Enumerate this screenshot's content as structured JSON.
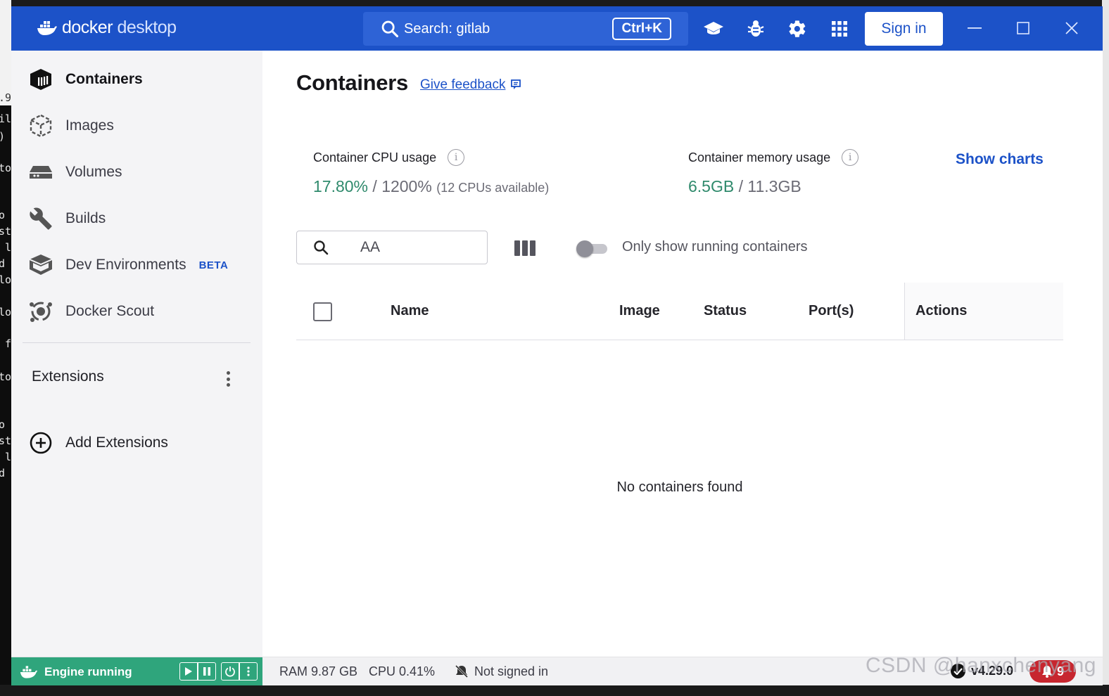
{
  "app": {
    "brand_primary": "docker",
    "brand_secondary": "desktop",
    "accent": "#1c52c8"
  },
  "titlebar": {
    "search_text": "Search: gitlab",
    "search_shortcut": "Ctrl+K",
    "icons": [
      "learning-center-icon",
      "troubleshoot-bug-icon",
      "settings-gear-icon",
      "extensions-grid-icon"
    ],
    "signin_label": "Sign in",
    "window_controls": [
      "minimize",
      "maximize",
      "close"
    ]
  },
  "sidebar": {
    "items": [
      {
        "label": "Containers",
        "icon": "containers-icon",
        "active": true
      },
      {
        "label": "Images",
        "icon": "images-icon"
      },
      {
        "label": "Volumes",
        "icon": "volumes-icon"
      },
      {
        "label": "Builds",
        "icon": "builds-wrench-icon"
      },
      {
        "label": "Dev Environments",
        "icon": "dev-environments-icon",
        "badge": "BETA"
      },
      {
        "label": "Docker Scout",
        "icon": "docker-scout-icon"
      }
    ],
    "extensions_title": "Extensions",
    "add_extensions_label": "Add Extensions"
  },
  "main": {
    "title": "Containers",
    "feedback_label": "Give feedback",
    "cpu": {
      "label": "Container CPU usage",
      "used": "17.80%",
      "sep": " / ",
      "total": "1200%",
      "note": "(12 CPUs available)"
    },
    "memory": {
      "label": "Container memory usage",
      "used": "6.5GB",
      "sep": " / ",
      "total": "11.3GB"
    },
    "show_charts_label": "Show charts",
    "search_value": "AA",
    "running_toggle_label": "Only show running containers",
    "running_toggle_on": false,
    "columns": [
      "Name",
      "Image",
      "Status",
      "Port(s)",
      "Actions"
    ],
    "empty_message": "No containers found"
  },
  "footer": {
    "engine_status": "Engine running",
    "ram": "RAM 9.87 GB",
    "cpu": "CPU 0.41%",
    "signin_status": "Not signed in",
    "version": "v4.29.0",
    "notifications": "9",
    "engine_color": "#2fa57c",
    "notification_color": "#c7262f"
  },
  "watermark": "CSDN @hanxchenyang"
}
